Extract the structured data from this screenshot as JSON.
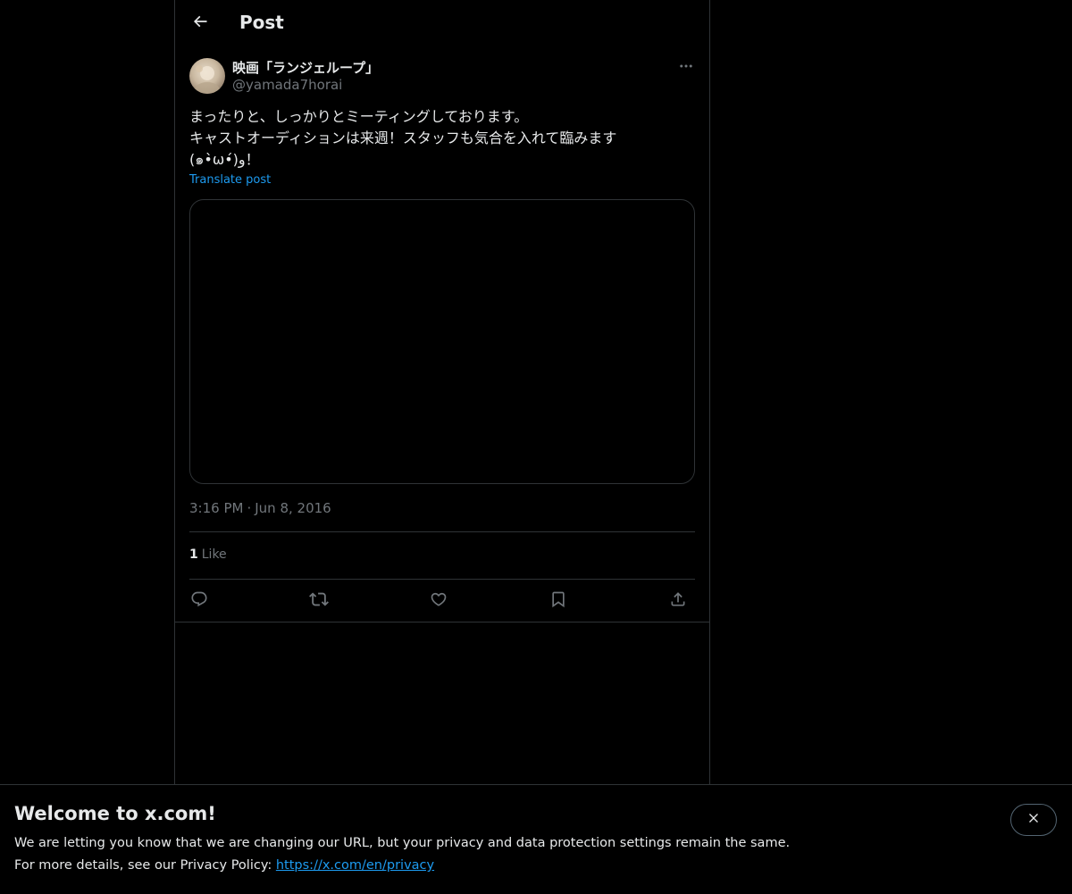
{
  "header": {
    "title": "Post",
    "back_icon": "arrow-left-icon"
  },
  "post": {
    "author": {
      "display_name": "映画「ランジェループ」",
      "handle": "@yamada7horai"
    },
    "text_lines": [
      "まったりと、しっかりとミーティングしております。",
      "キャストオーディションは来週！スタッフも気合を入れて臨みます",
      "(๑•̀ω•́)و！"
    ],
    "translate_label": "Translate post",
    "time": "3:16 PM",
    "separator": "·",
    "date": "Jun 8, 2016",
    "likes_count": "1",
    "likes_label": "Like",
    "actions": [
      "reply-icon",
      "repost-icon",
      "like-icon",
      "bookmark-icon",
      "share-icon"
    ]
  },
  "banner": {
    "title": "Welcome to x.com!",
    "line1": "We are letting you know that we are changing our URL, but your privacy and data protection settings remain the same.",
    "line2_prefix": "For more details, see our Privacy Policy: ",
    "link": "https://x.com/en/privacy"
  },
  "colors": {
    "background": "#000000",
    "text": "#e7e9ea",
    "secondary": "#71767b",
    "accent": "#1d9bf0",
    "border": "#2f3336"
  }
}
